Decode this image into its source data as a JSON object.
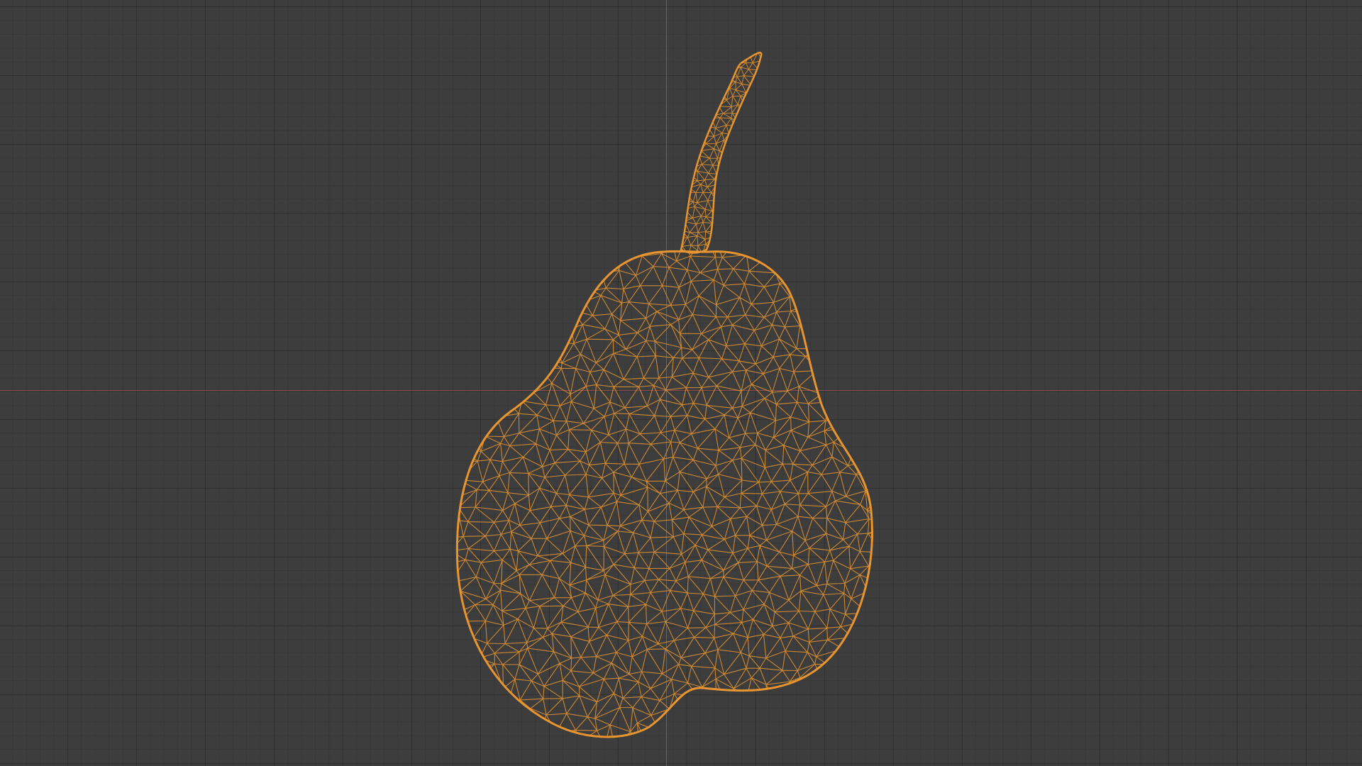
{
  "viewport": {
    "background": "#3d3d3d",
    "grid_visible": true,
    "x_axis_color": "#8a4a4a",
    "y_axis_color": "#4a6a9a"
  },
  "object": {
    "name": "pear",
    "shading": "wireframe",
    "selected": true,
    "wire_color": "#e8952f"
  }
}
